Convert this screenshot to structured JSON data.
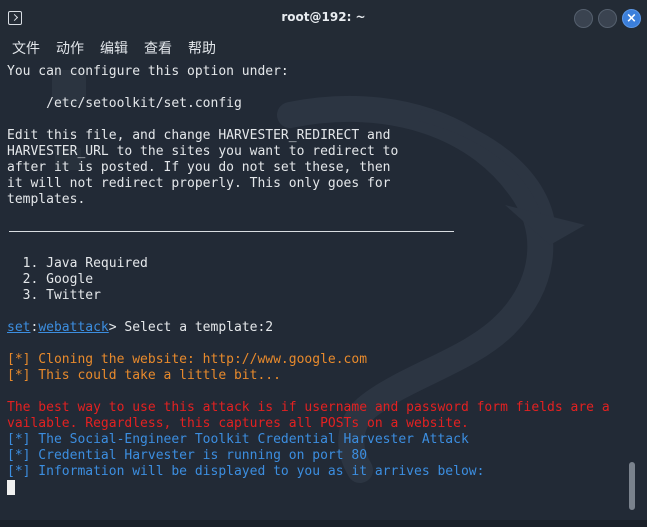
{
  "window": {
    "title": "root@192: ~",
    "close_glyph": "×"
  },
  "menu": [
    "文件",
    "动作",
    "编辑",
    "查看",
    "帮助"
  ],
  "terminal": {
    "lines": {
      "l1": "You can configure this option under:",
      "l2": "     /etc/setoolkit/set.config",
      "l3": "Edit this file, and change HARVESTER_REDIRECT and",
      "l4": "HARVESTER_URL to the sites you want to redirect to",
      "l5": "after it is posted. If you do not set these, then",
      "l6": "it will not redirect properly. This only goes for",
      "l7": "templates.",
      "opt1": "  1. Java Required",
      "opt2": "  2. Google",
      "opt3": "  3. Twitter",
      "prompt_set": "set",
      "prompt_colon": ":",
      "prompt_module": "webattack",
      "prompt_rest": "> Select a template:2",
      "clone1": "[*] Cloning the website: http://www.google.com",
      "clone2": "[*] This could take a little bit...",
      "warn1": "The best way to use this attack is if username and password form fields are a",
      "warn2": "vailable. Regardless, this captures all POSTs on a website.",
      "info1": "[*] The Social-Engineer Toolkit Credential Harvester Attack",
      "info2": "[*] Credential Harvester is running on port 80",
      "info3": "[*] Information will be displayed to you as it arrives below:"
    }
  },
  "colors": {
    "background": "#222a36",
    "text": "#e4e7ea",
    "orange": "#e88a2c",
    "red": "#e32121",
    "blue": "#3c8ee0",
    "close_button": "#3b7fdb"
  },
  "icons": [
    "terminal-icon",
    "minimize-icon",
    "maximize-icon",
    "close-icon",
    "kali-dragon-watermark"
  ]
}
